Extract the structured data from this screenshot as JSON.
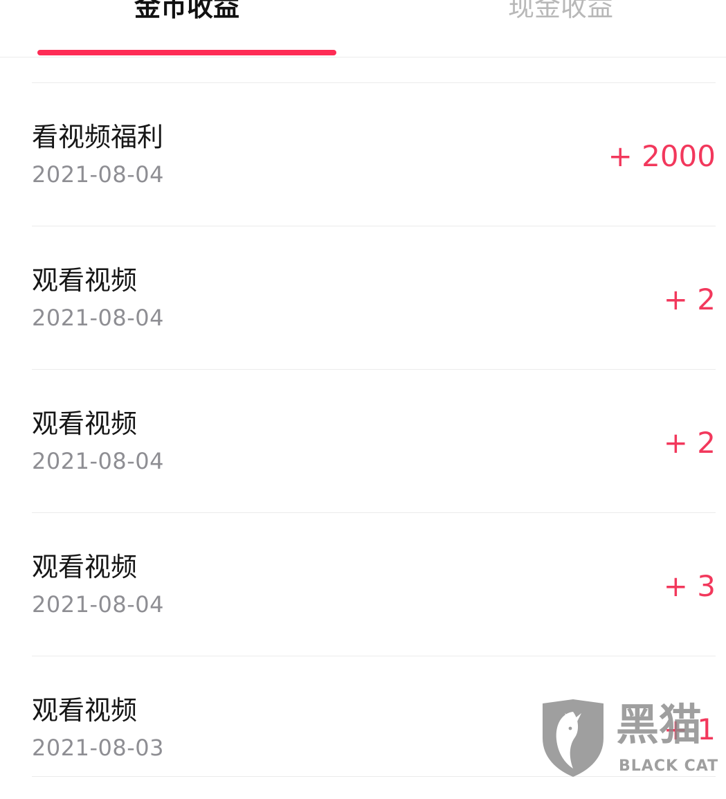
{
  "tabs": [
    {
      "label": "金币收益",
      "active": true
    },
    {
      "label": "现金收益",
      "active": false
    }
  ],
  "records": [
    {
      "title": "看视频福利",
      "date": "2021-08-04",
      "amount": "+ 2000"
    },
    {
      "title": "观看视频",
      "date": "2021-08-04",
      "amount": "+ 2"
    },
    {
      "title": "观看视频",
      "date": "2021-08-04",
      "amount": "+ 2"
    },
    {
      "title": "观看视频",
      "date": "2021-08-04",
      "amount": "+ 3"
    },
    {
      "title": "观看视频",
      "date": "2021-08-03",
      "amount": "+ 1"
    }
  ],
  "watermark": {
    "text": "黑猫",
    "sub": "BLACK CAT",
    "icon": "black-cat-shield-logo"
  },
  "colors": {
    "accent": "#fe2c55",
    "amount": "#f2385c",
    "date": "#8e8e93",
    "tab_inactive": "#b8b8b8"
  }
}
